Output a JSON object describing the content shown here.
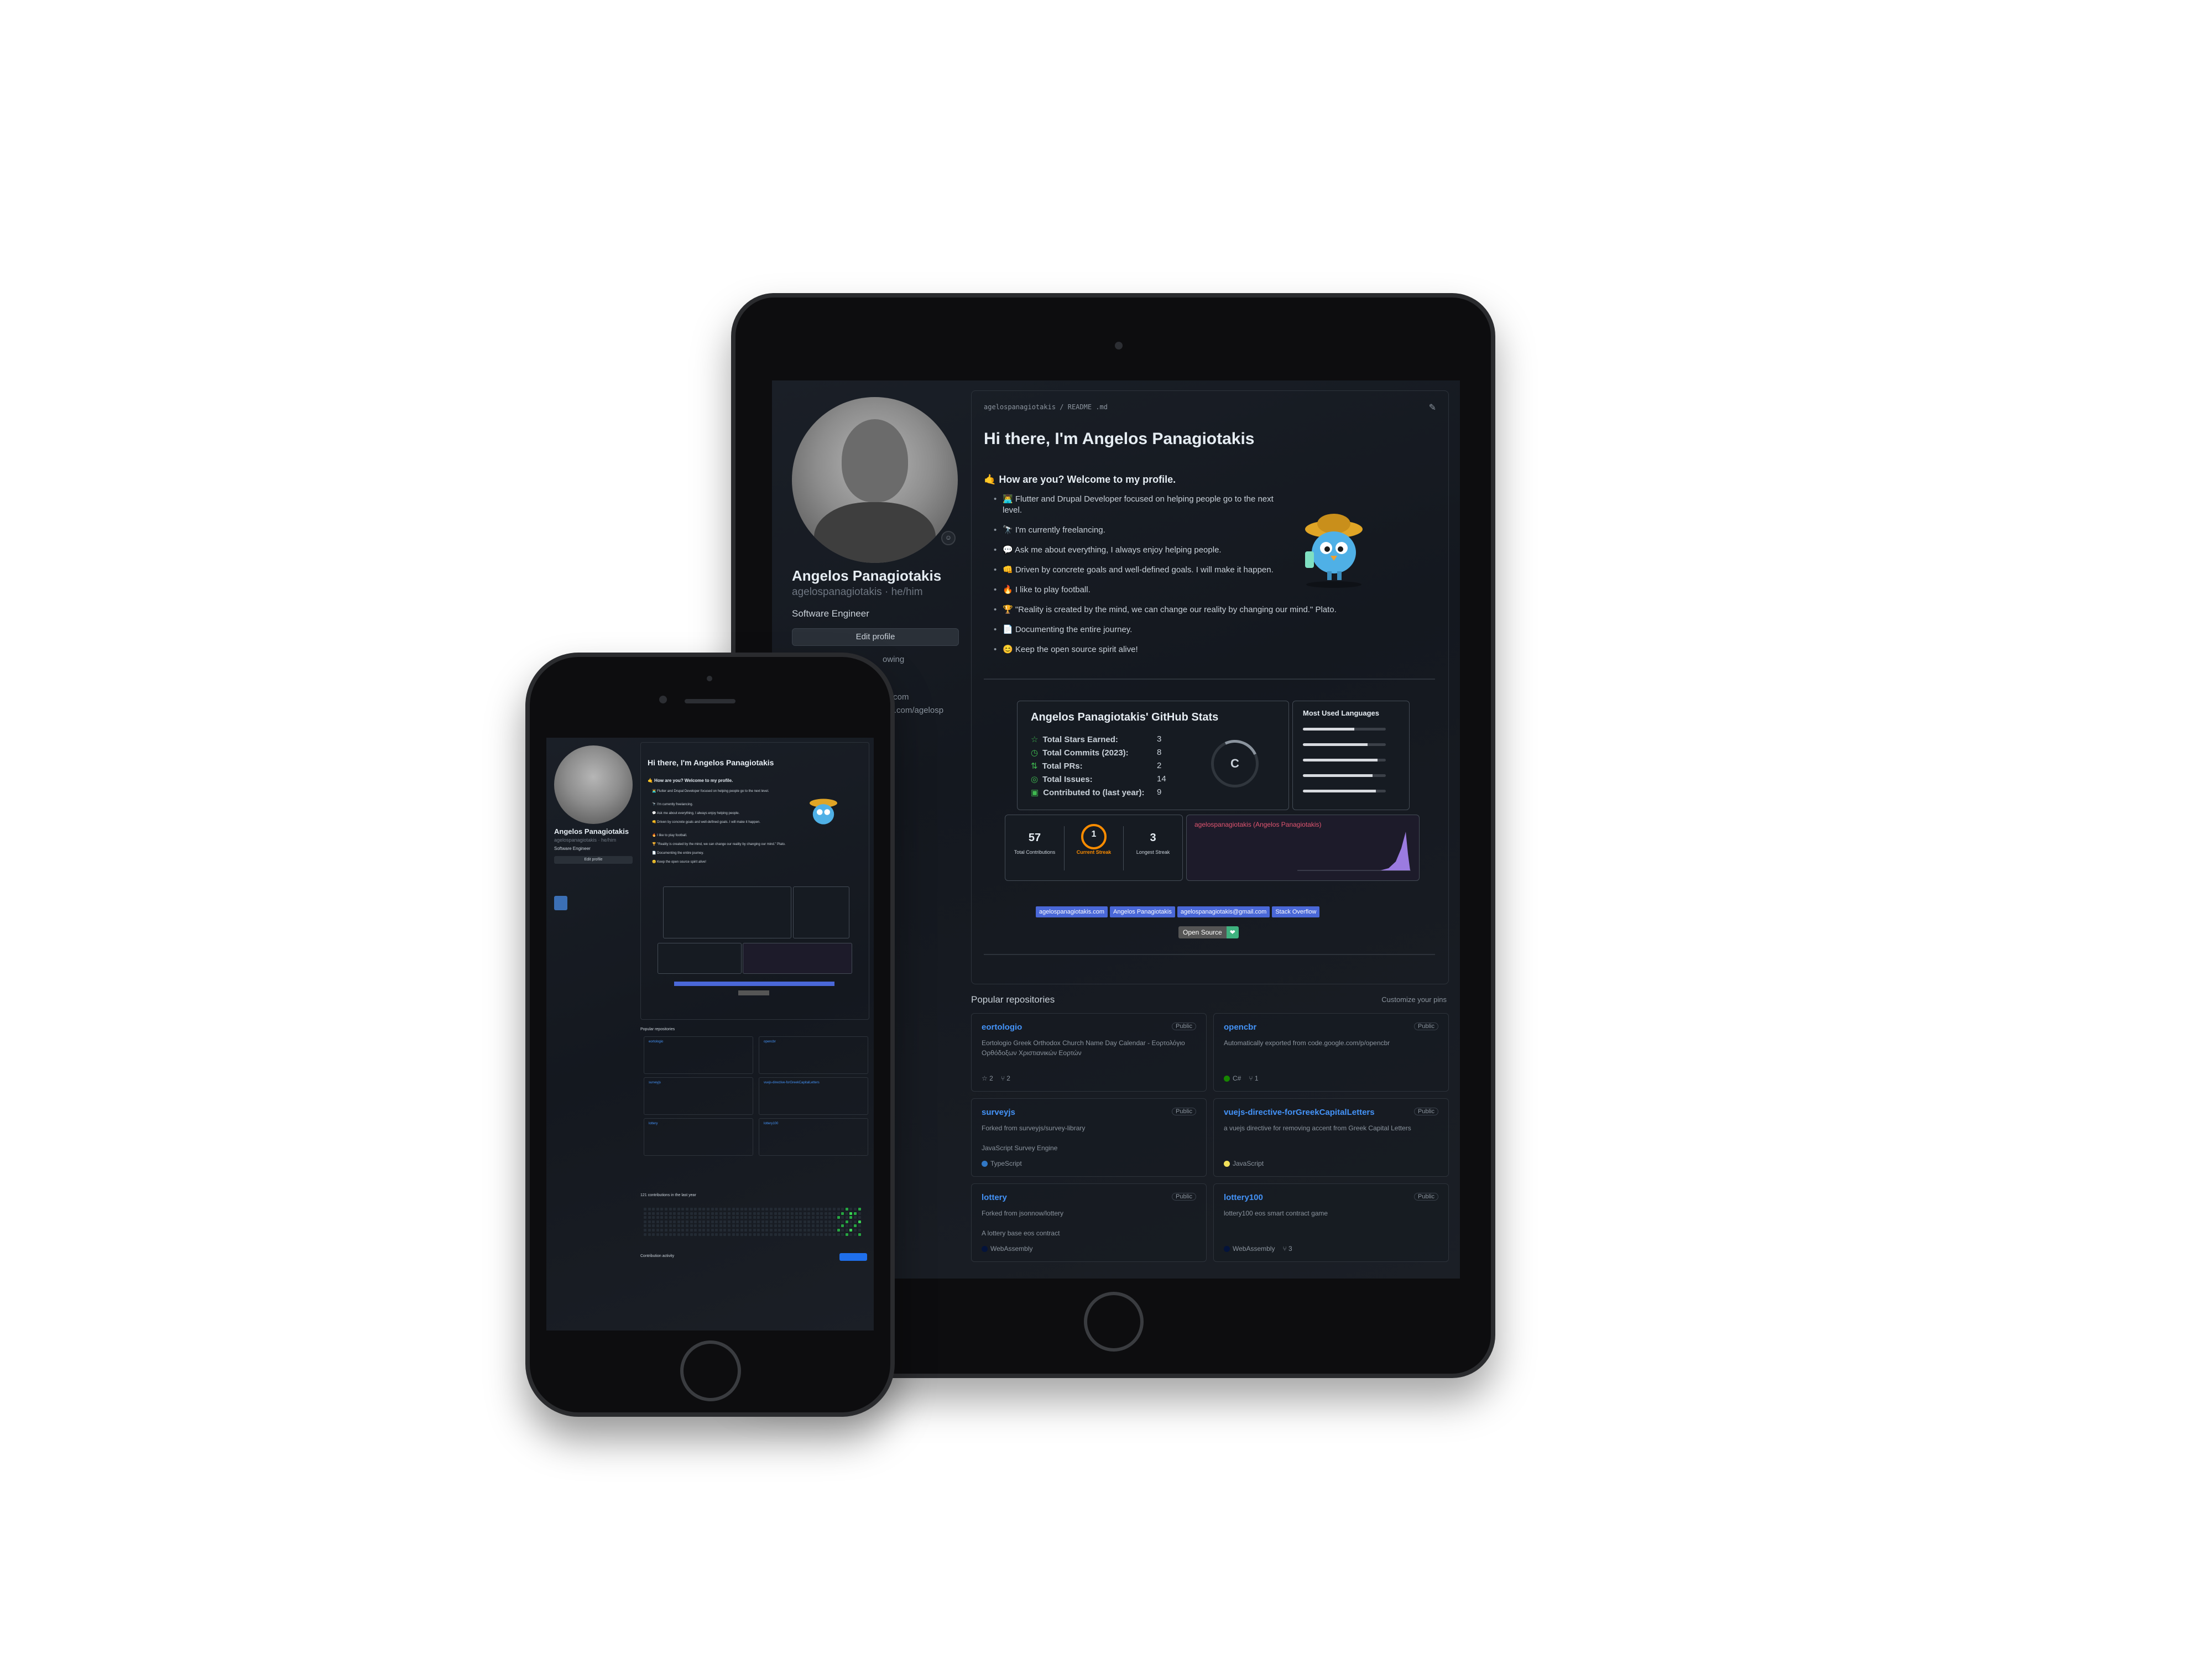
{
  "profile": {
    "name": "Angelos Panagiotakis",
    "handle": "agelospanagiotakis · he/him",
    "bio": "Software Engineer",
    "edit_button": "Edit profile",
    "frag_following": "owing",
    "frag_email": "ail.com",
    "frag_site": "fee.com/agelosp"
  },
  "readme": {
    "breadcrumb": "agelospanagiotakis / README .md",
    "title": "Hi there, I'm Angelos Panagiotakis",
    "subtitle": "🤙 How are you? Welcome to my profile.",
    "items": [
      "👨‍💻 Flutter and Drupal Developer focused on helping people go to the next level.",
      "🔭 I'm currently freelancing.",
      "💬 Ask me about everything, I always enjoy helping people.",
      "👊 Driven by concrete goals and well-defined goals. I will make it happen.",
      "🔥 I like to play football.",
      "🏆 \"Reality is created by the mind, we can change our reality by changing our mind.\" Plato.",
      "📄 Documenting the entire journey.",
      "😊 Keep the open source spirit alive!"
    ]
  },
  "github_stats": {
    "title": "Angelos Panagiotakis' GitHub Stats",
    "grade": "C",
    "rows": [
      {
        "label": "Total Stars Earned:",
        "value": "3",
        "icon": "☆"
      },
      {
        "label": "Total Commits (2023):",
        "value": "8",
        "icon": "◷"
      },
      {
        "label": "Total PRs:",
        "value": "2",
        "icon": "⇅"
      },
      {
        "label": "Total Issues:",
        "value": "14",
        "icon": "◎"
      },
      {
        "label": "Contributed to (last year):",
        "value": "9",
        "icon": "▣"
      }
    ]
  },
  "languages": {
    "title": "Most Used Languages",
    "bars": [
      0.62,
      0.78,
      0.9,
      0.84,
      0.88
    ]
  },
  "streak": {
    "total_contributions": "57",
    "total_contributions_label": "Total Contributions",
    "current_streak": "1",
    "current_streak_label": "Current Streak",
    "longest_streak": "3",
    "longest_streak_label": "Longest Streak"
  },
  "activity": {
    "title": "agelospanagiotakis (Angelos Panagiotakis)"
  },
  "badges": [
    "agelospanagiotakis.com",
    "Angelos Panagiotakis",
    "agelospanagiotakis@gmail.com",
    "Stack Overflow"
  ],
  "open_source_badge": {
    "left": "Open Source",
    "right": "❤"
  },
  "popular": {
    "heading": "Popular repositories",
    "customize": "Customize your pins",
    "repos": [
      {
        "name": "eortologio",
        "visibility": "Public",
        "desc": "Eortologio Greek Orthodox Church Name Day Calendar - Εορτολόγιο Ορθόδοξων Χριστιανικών Εορτών",
        "lang": "",
        "lang_color": "",
        "stars": "2",
        "forks": "2"
      },
      {
        "name": "opencbr",
        "visibility": "Public",
        "desc": "Automatically exported from code.google.com/p/opencbr",
        "lang": "C#",
        "lang_color": "#178600",
        "stars": "",
        "forks": "1"
      },
      {
        "name": "surveyjs",
        "visibility": "Public",
        "desc": "Forked from surveyjs/survey-library\n\nJavaScript Survey Engine",
        "lang": "TypeScript",
        "lang_color": "#3178c6",
        "stars": "",
        "forks": ""
      },
      {
        "name": "vuejs-directive-forGreekCapitalLetters",
        "visibility": "Public",
        "desc": "a vuejs directive for removing accent from Greek Capital Letters",
        "lang": "JavaScript",
        "lang_color": "#f1e05a",
        "stars": "",
        "forks": ""
      },
      {
        "name": "lottery",
        "visibility": "Public",
        "desc": "Forked from jsonnow/lottery\n\nA lottery base eos contract",
        "lang": "WebAssembly",
        "lang_color": "#04133b",
        "stars": "",
        "forks": ""
      },
      {
        "name": "lottery100",
        "visibility": "Public",
        "desc": "lottery100 eos smart contract game",
        "lang": "WebAssembly",
        "lang_color": "#04133b",
        "stars": "",
        "forks": "3"
      }
    ]
  },
  "phone": {
    "contributions_heading": "121 contributions in the last year",
    "activity_heading": "Contribution activity"
  }
}
